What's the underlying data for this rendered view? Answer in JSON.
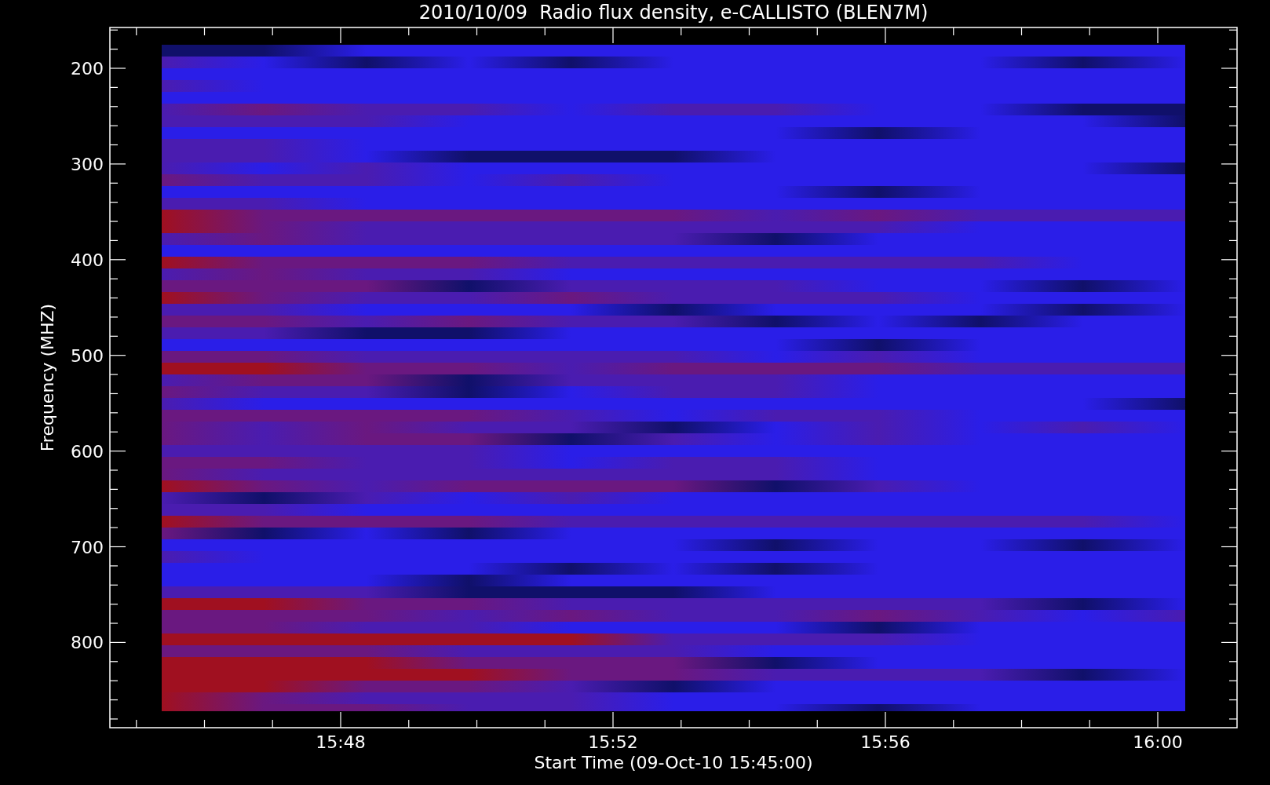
{
  "title": "2010/10/09  Radio flux density, e-CALLISTO (BLEN7M)",
  "y_axis": {
    "label": "Frequency (MHZ)",
    "ticks": [
      "200",
      "300",
      "400",
      "500",
      "600",
      "700",
      "800"
    ]
  },
  "x_axis": {
    "label": "Start Time (09-Oct-10 15:45:00)",
    "ticks": [
      "15:48",
      "15:52",
      "15:56",
      "16:00"
    ]
  }
}
